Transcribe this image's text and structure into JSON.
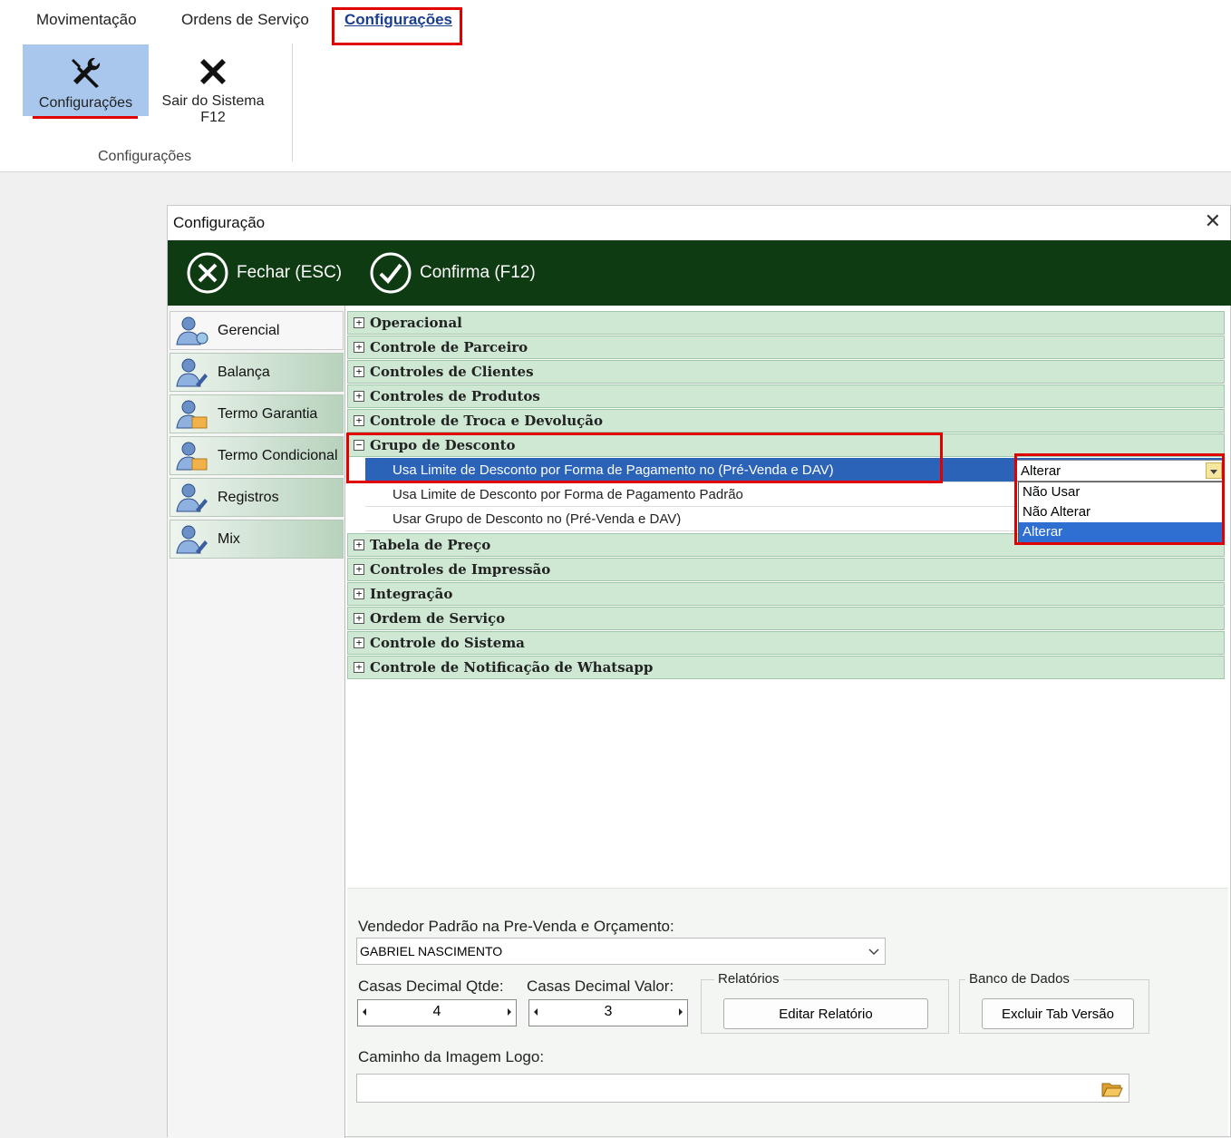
{
  "ribbon": {
    "tabs": [
      {
        "label": "Movimentação"
      },
      {
        "label": "Ordens de Serviço"
      },
      {
        "label": "Configurações"
      }
    ],
    "buttons": {
      "config_label": "Configurações",
      "exit_label": "Sair do Sistema",
      "exit_shortcut": "F12"
    },
    "group_label": "Configurações"
  },
  "dialog": {
    "title": "Configuração",
    "close_glyph": "✕",
    "toolbar": {
      "close_label": "Fechar (ESC)",
      "confirm_label": "Confirma (F12)"
    },
    "side_tabs": [
      {
        "label": "Gerencial"
      },
      {
        "label": "Balança"
      },
      {
        "label": "Termo Garantia"
      },
      {
        "label": "Termo Condicional"
      },
      {
        "label": "Registros"
      },
      {
        "label": "Mix"
      }
    ],
    "tree": {
      "expand_glyph": "+",
      "collapse_glyph": "−",
      "groups_before": [
        "Operacional",
        "Controle de Parceiro",
        "Controles de Clientes",
        "Controles de Produtos",
        "Controle de Troca e Devolução"
      ],
      "open_group": {
        "label": "Grupo de Desconto",
        "items": [
          "Usa Limite de Desconto por Forma de Pagamento no  (Pré-Venda e DAV)",
          "Usa Limite de Desconto por Forma de Pagamento Padrão",
          "Usar Grupo de Desconto no  (Pré-Venda e DAV)"
        ]
      },
      "groups_after": [
        "Tabela de Preço",
        "Controles de Impressão",
        "Integração",
        "Ordem de Serviço",
        "Controle do Sistema",
        "Controle de Notificação de Whatsapp"
      ]
    },
    "combo": {
      "value": "Alterar",
      "options": [
        "Não Usar",
        "Não Alterar",
        "Alterar"
      ]
    },
    "bottom": {
      "vendedor_label": "Vendedor Padrão na Pre-Venda e Orçamento:",
      "vendedor_value": "GABRIEL NASCIMENTO",
      "casas_qtde_label": "Casas Decimal Qtde:",
      "casas_qtde_value": "4",
      "casas_valor_label": "Casas Decimal Valor:",
      "casas_valor_value": "3",
      "relatorios_legend": "Relatórios",
      "editar_label": "Editar Relatório",
      "banco_legend": "Banco de Dados",
      "excluir_label": "Excluir Tab Versão",
      "logo_label": "Caminho da Imagem Logo:",
      "logo_value": ""
    }
  },
  "colors": {
    "toolbar_bg": "#0e3b12",
    "tree_row_bg": "#cfe8d4",
    "selection": "#2b63b9",
    "highlight_box": "#e00000"
  }
}
